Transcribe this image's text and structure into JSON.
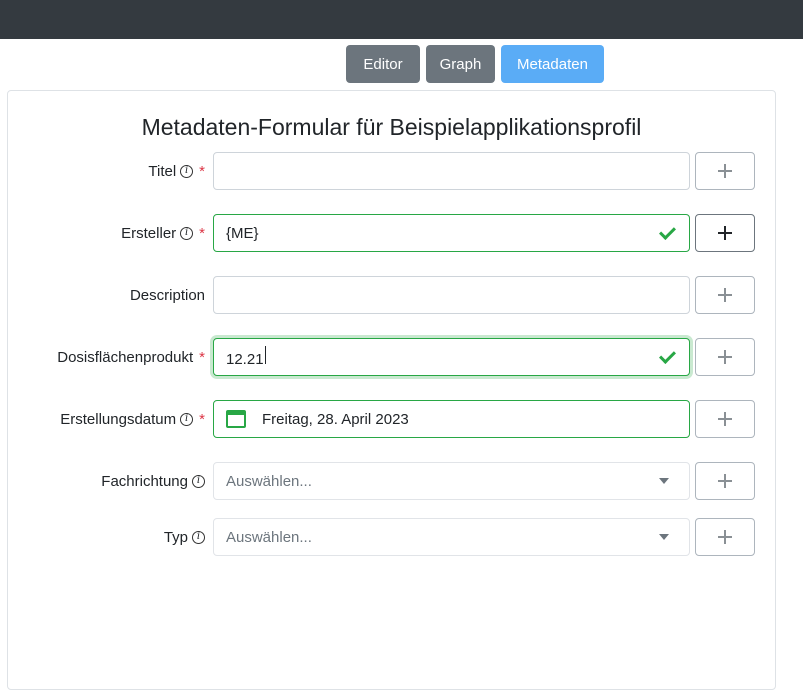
{
  "tabs": [
    {
      "label": "Editor"
    },
    {
      "label": "Graph"
    },
    {
      "label": "Metadaten"
    }
  ],
  "form": {
    "title": "Metadaten-Formular für Beispielapplikationsprofil",
    "required_mark": "*",
    "info_glyph": "i",
    "fields": [
      {
        "label": "Titel",
        "value": ""
      },
      {
        "label": "Ersteller",
        "value": "{ME}"
      },
      {
        "label": "Description",
        "value": ""
      },
      {
        "label": "Dosisflächenprodukt",
        "value": "12.21"
      },
      {
        "label": "Erstellungsdatum",
        "value": "Freitag, 28. April 2023"
      },
      {
        "label": "Fachrichtung",
        "placeholder": "Auswählen..."
      },
      {
        "label": "Typ",
        "placeholder": "Auswählen..."
      }
    ]
  },
  "colors": {
    "topbar": "#343a40",
    "tab_inactive": "#6c757d",
    "tab_active": "#5aacf6",
    "valid": "#28a745",
    "required": "#dc3545"
  }
}
